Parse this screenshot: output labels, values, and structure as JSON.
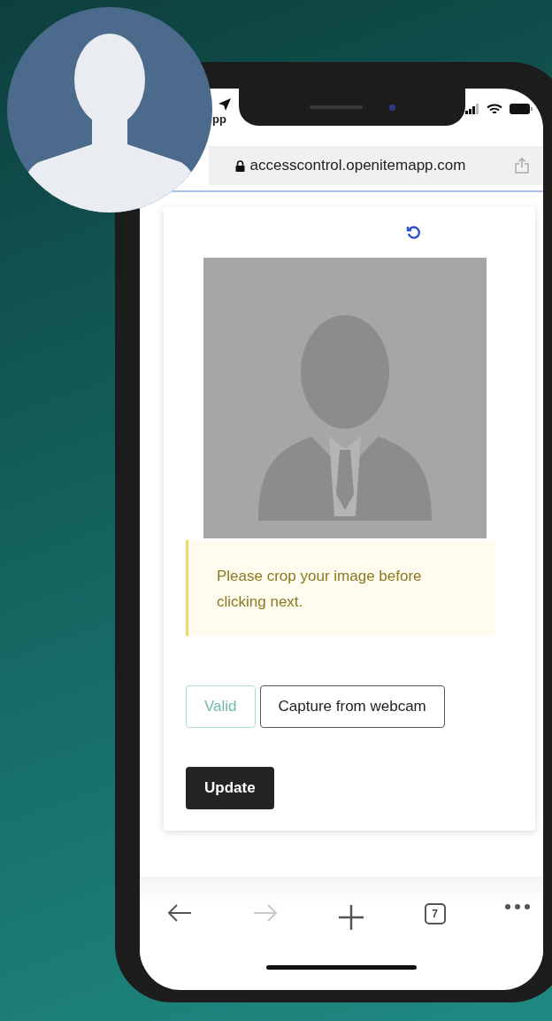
{
  "status_bar": {
    "app_label": "pp"
  },
  "address_bar": {
    "url": "accesscontrol.openitemapp.com"
  },
  "alert": {
    "message": "Please crop your image before clicking next."
  },
  "buttons": [
    {
      "label": "Valid",
      "kind": "outline-teal"
    },
    {
      "label": "Capture from webcam",
      "kind": "outline"
    }
  ],
  "submit_button": {
    "label": "Update"
  },
  "toolbar": [
    {
      "kind": "back",
      "disabled": false
    },
    {
      "kind": "forward",
      "disabled": true
    },
    {
      "kind": "new-tab",
      "disabled": false
    },
    {
      "kind": "tabs",
      "label": "7",
      "disabled": false
    },
    {
      "kind": "more",
      "disabled": false
    }
  ]
}
